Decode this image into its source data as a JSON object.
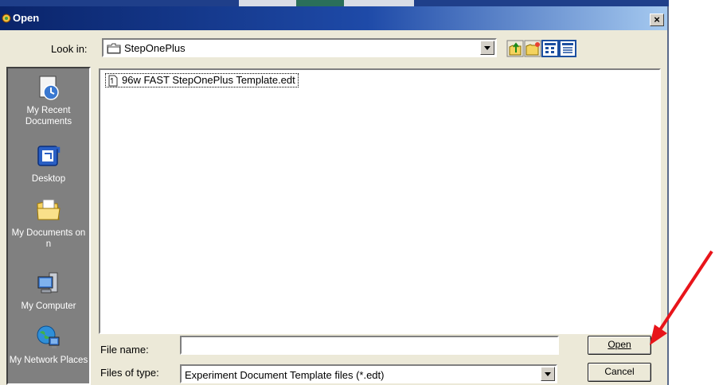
{
  "window": {
    "title": "Open",
    "close_glyph": "×"
  },
  "lookin": {
    "label": "Look in:",
    "value": "StepOnePlus"
  },
  "toolbar": {
    "icons": [
      "up-folder-icon",
      "new-folder-icon",
      "list-view-icon",
      "details-view-icon"
    ]
  },
  "places": [
    {
      "label": "My Recent Documents",
      "icon": "recent-documents-icon"
    },
    {
      "label": "Desktop",
      "icon": "desktop-icon"
    },
    {
      "label": "My Documents on n",
      "icon": "my-documents-icon"
    },
    {
      "label": "My Computer",
      "icon": "my-computer-icon"
    },
    {
      "label": "My Network Places",
      "icon": "network-places-icon"
    }
  ],
  "files": [
    {
      "name": "96w FAST StepOnePlus Template.edt",
      "icon": "document-icon"
    }
  ],
  "filename": {
    "label": "File name:",
    "value": ""
  },
  "filetype": {
    "label": "Files of type:",
    "value": "Experiment Document Template files (*.edt)"
  },
  "buttons": {
    "open": "Open",
    "cancel": "Cancel"
  },
  "colors": {
    "titlebar": "#0a246a",
    "annotation_arrow": "#e8141a",
    "places_bg": "#808080"
  }
}
